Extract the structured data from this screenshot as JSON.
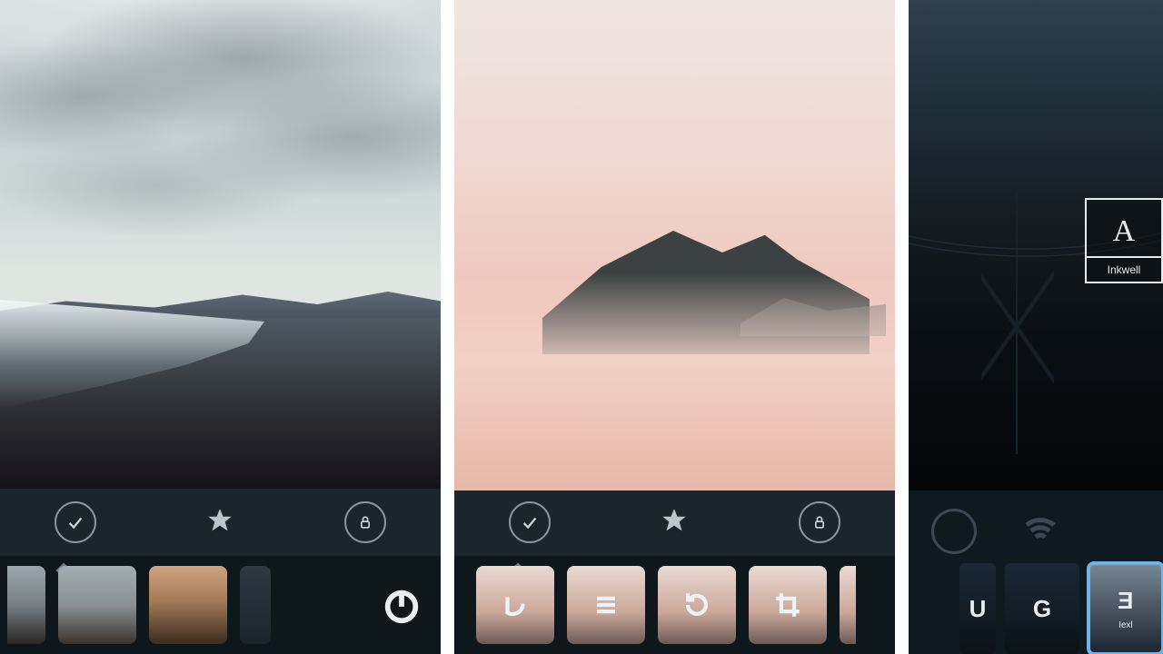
{
  "panels": [
    {
      "tools": [
        "checkmark-circle",
        "star",
        "lock-circle"
      ],
      "indicator_on_first": true,
      "thumbs": [
        "preset-1",
        "preset-2",
        "preset-3",
        "preset-4"
      ],
      "power_button": true
    },
    {
      "tools": [
        "checkmark-circle",
        "star",
        "lock-circle"
      ],
      "indicator_on_first": true,
      "tool_icons": [
        "undo",
        "levels",
        "rotate",
        "crop"
      ]
    },
    {
      "filter_card": {
        "glyph": "A",
        "label": "Inkwell"
      },
      "dim_tools": [
        "ring",
        "wifi"
      ],
      "thumbs": [
        {
          "icon": "undo"
        },
        {
          "icon": "contrast"
        },
        {
          "icon": "reverse-E",
          "label": "Iexl",
          "selected": true
        }
      ]
    }
  ]
}
